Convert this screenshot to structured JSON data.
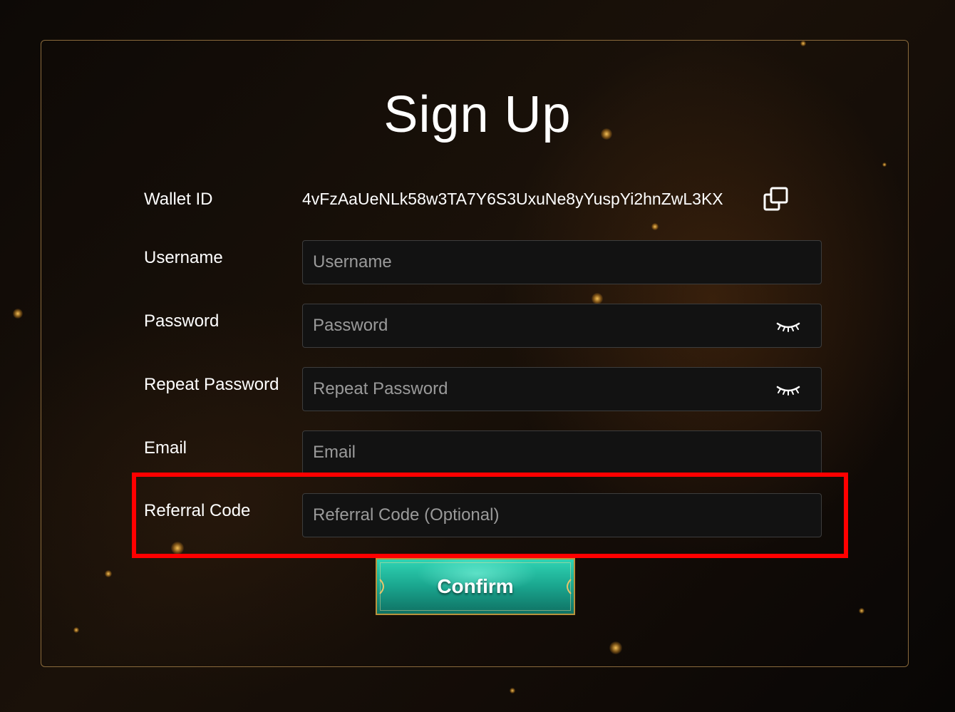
{
  "page": {
    "title": "Sign Up"
  },
  "form": {
    "wallet": {
      "label": "Wallet ID",
      "value": "4vFzAaUeNLk58w3TA7Y6S3UxuNe8yYuspYi2hnZwL3KX",
      "copy_icon": "copy-icon"
    },
    "username": {
      "label": "Username",
      "placeholder": "Username",
      "value": ""
    },
    "password": {
      "label": "Password",
      "placeholder": "Password",
      "value": "",
      "toggle_icon": "eye-closed-icon"
    },
    "repeat_password": {
      "label": "Repeat Password",
      "placeholder": "Repeat Password",
      "value": "",
      "toggle_icon": "eye-closed-icon"
    },
    "email": {
      "label": "Email",
      "placeholder": "Email",
      "value": ""
    },
    "referral": {
      "label": "Referral Code",
      "placeholder": "Referral Code (Optional)",
      "value": ""
    },
    "confirm_label": "Confirm"
  },
  "colors": {
    "background": "#120c07",
    "panel_border": "#8a6a3c",
    "field_background": "#121212",
    "field_border": "#3d3d3d",
    "highlight": "#ff0000",
    "confirm_button": "#1aa58e"
  }
}
